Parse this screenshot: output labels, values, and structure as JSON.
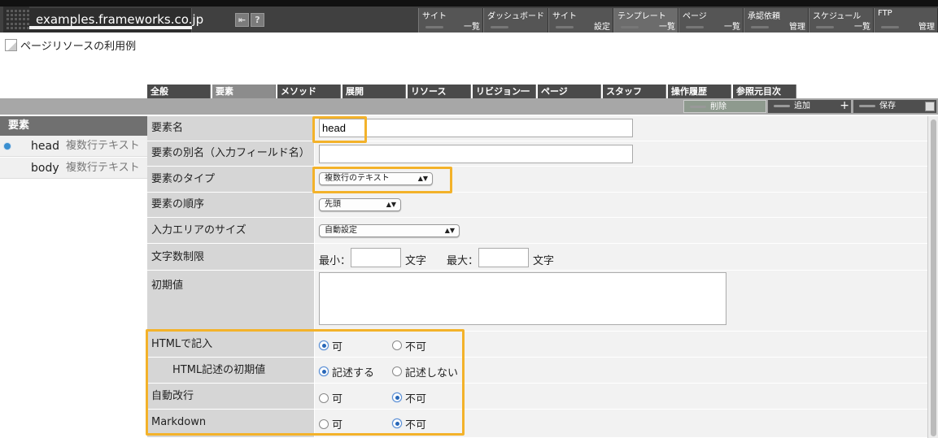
{
  "header": {
    "site_name": "examples.frameworks.co.jp",
    "help_glyph": "?",
    "nav": [
      {
        "line1": "サイト",
        "line2": "一覧"
      },
      {
        "line1": "ダッシュボード",
        "line2": ""
      },
      {
        "line1": "サイト",
        "line2": "設定"
      },
      {
        "line1": "テンプレート",
        "line2": "一覧"
      },
      {
        "line1": "ページ",
        "line2": "一覧"
      },
      {
        "line1": "承認依頼",
        "line2": "管理"
      },
      {
        "line1": "スケジュール",
        "line2": "一覧"
      },
      {
        "line1": "FTP",
        "line2": "管理"
      }
    ]
  },
  "page": {
    "title": "ページリソースの利用例"
  },
  "tabs": [
    "全般",
    "要素",
    "メソッド",
    "展開",
    "リソース",
    "リビジョン一覧",
    "ページ",
    "スタッフ",
    "操作履歴",
    "参照元目次"
  ],
  "actions": {
    "delete": "削除",
    "add": "追加",
    "save": "保存"
  },
  "sidebar": {
    "title": "要素",
    "items": [
      {
        "name": "head",
        "type": "複数行テキスト",
        "selected": true
      },
      {
        "name": "body",
        "type": "複数行テキスト",
        "selected": false
      }
    ]
  },
  "form": {
    "element_name": {
      "label": "要素名",
      "value": "head"
    },
    "alias": {
      "label": "要素の別名（入力フィールド名）",
      "value": ""
    },
    "element_type": {
      "label": "要素のタイプ",
      "value": "複数行のテキスト"
    },
    "order": {
      "label": "要素の順序",
      "value": "先頭"
    },
    "area_size": {
      "label": "入力エリアのサイズ",
      "value": "自動設定"
    },
    "char_limit": {
      "label": "文字数制限",
      "min_label": "最小：",
      "max_label": "最大：",
      "unit": "文字",
      "min": "",
      "max": ""
    },
    "default_value": {
      "label": "初期値",
      "value": ""
    },
    "html": {
      "label": "HTMLで記入",
      "opt_yes": "可",
      "opt_no": "不可",
      "selected": "可"
    },
    "html_default": {
      "label": "HTML記述の初期値",
      "opt_yes": "記述する",
      "opt_no": "記述しない",
      "selected": "記述する"
    },
    "auto_break": {
      "label": "自動改行",
      "opt_yes": "可",
      "opt_no": "不可",
      "selected": "不可"
    },
    "markdown": {
      "label": "Markdown",
      "opt_yes": "可",
      "opt_no": "不可",
      "selected": "不可"
    }
  },
  "colors": {
    "highlight": "#f3b22a",
    "header_bg": "#404040",
    "radio_on": "#2867b8"
  }
}
